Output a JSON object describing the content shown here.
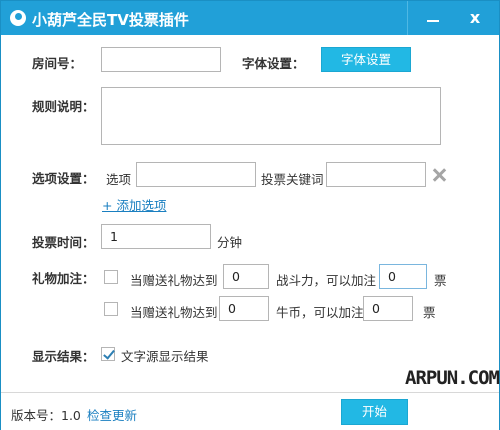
{
  "window": {
    "title": "小葫芦全民TV投票插件",
    "minimize_label": "",
    "close_label": "x"
  },
  "form": {
    "room": {
      "label": "房间号：",
      "value": ""
    },
    "font": {
      "label": "字体设置：",
      "button": "字体设置"
    },
    "rules": {
      "label": "规则说明：",
      "value": ""
    },
    "options": {
      "label": "选项设置：",
      "option_label": "选项",
      "option_value": "",
      "keyword_label": "投票关键词",
      "keyword_value": "",
      "add_link": "+ 添加选项"
    },
    "time": {
      "label": "投票时间：",
      "value": "1",
      "unit": "分钟"
    },
    "gift": {
      "label": "礼物加注：",
      "rows": [
        {
          "checked": false,
          "prefix": "当赠送礼物达到",
          "amount": "0",
          "middle": "战斗力，可以加注",
          "votes": "0",
          "suffix": "票"
        },
        {
          "checked": false,
          "prefix": "当赠送礼物达到",
          "amount": "0",
          "middle": "牛币，可以加注",
          "votes": "0",
          "suffix": "票"
        }
      ]
    },
    "display": {
      "label": "显示结果：",
      "checked": true,
      "option_text": "文字源显示结果"
    }
  },
  "footer": {
    "version_text": "版本号：1.0",
    "update_link": "检查更新",
    "start_button": "开始",
    "watermark": "ARPUN.COM"
  },
  "colors": {
    "titlebar": "#21a0d8",
    "accent_button": "#22b8e4",
    "link": "#1a7fc0"
  }
}
